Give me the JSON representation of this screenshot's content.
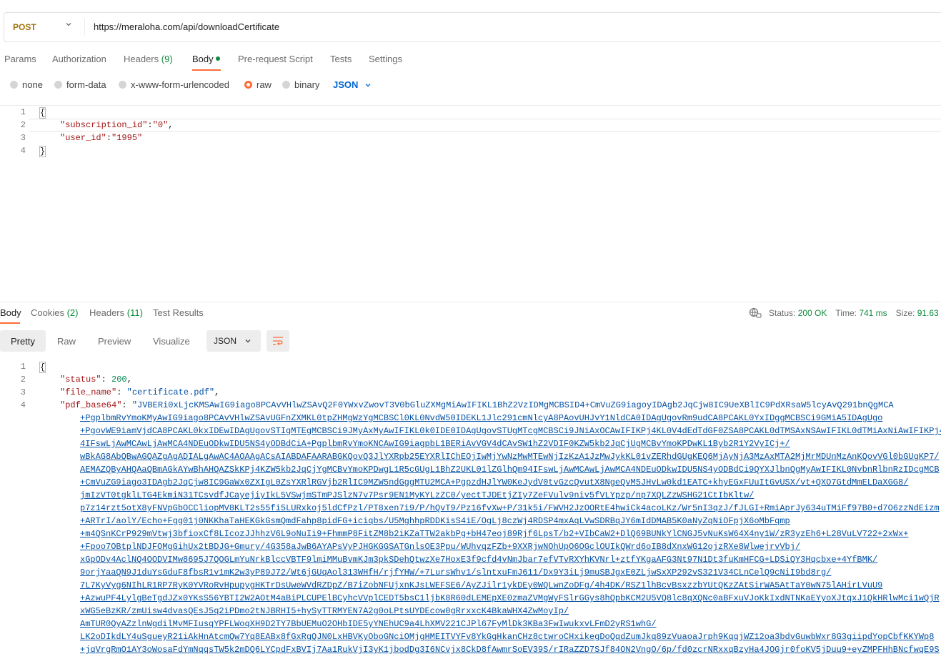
{
  "request": {
    "method": "POST",
    "url": "https://meraloha.com/api/downloadCertificate",
    "tabs": [
      {
        "label": "Params",
        "count": ""
      },
      {
        "label": "Authorization",
        "count": ""
      },
      {
        "label": "Headers",
        "count": "(9)"
      },
      {
        "label": "Body",
        "count": ""
      },
      {
        "label": "Pre-request Script",
        "count": ""
      },
      {
        "label": "Tests",
        "count": ""
      },
      {
        "label": "Settings",
        "count": ""
      }
    ],
    "active_tab": "Body",
    "body_types": [
      "none",
      "form-data",
      "x-www-form-urlencoded",
      "raw",
      "binary"
    ],
    "selected_body_type": "raw",
    "format": "JSON",
    "line_numbers": [
      "1",
      "2",
      "3",
      "4"
    ],
    "body_lines": {
      "open": "{",
      "key1": "\"subscription_id\"",
      "val1": "\"0\"",
      "key2": "\"user_id\"",
      "val2": "\"1995\"",
      "close": "}"
    }
  },
  "response": {
    "tabs": [
      {
        "label": "Body",
        "count": ""
      },
      {
        "label": "Cookies",
        "count": "(2)"
      },
      {
        "label": "Headers",
        "count": "(11)"
      },
      {
        "label": "Test Results",
        "count": ""
      }
    ],
    "status_label": "Status:",
    "status_value": "200 OK",
    "time_label": "Time:",
    "time_value": "741 ms",
    "size_label": "Size:",
    "size_value": "91.63 KB",
    "view_tabs": [
      "Pretty",
      "Raw",
      "Preview",
      "Visualize"
    ],
    "format": "JSON",
    "line_numbers": [
      "1",
      "2",
      "3",
      "4"
    ],
    "json": {
      "open": "{",
      "status_key": "\"status\"",
      "status_value": "200",
      "file_name_key": "\"file_name\"",
      "file_name_value": "\"certificate.pdf\"",
      "pdf_key": "\"pdf_base64\"",
      "pdf_first": "\"JVBERi0xLjcKMSAwIG9iago8PCAvVHlwZSAvQ2F0YWxvZwovT3V0bGluZXMgMiAwIFIKL1BhZ2VzIDMgMCBSID4+CmVuZG9iagoyIDAgb2JqCjw8IC9UeXBlIC9PdXRsaW5lcyAvQ291bnQgMCA",
      "pdf_lines": [
        "+PgplbmRvYmoKMyAwIG9iago8PCAvVHlwZSAvUGFnZXMKL0tpZHMgWzYgMCBSCl0KL0NvdW50IDEKL1Jlc291cmNlcyA8PAovUHJvY1NldCA0IDAgUgovRm9udCA8PCAKL0YxIDggMCBSCi9GMiA5IDAgUgo",
        "+PgovWE9iamVjdCA8PCAKL0kxIDEwIDAgUgovSTIgMTEgMCBSCi9JMyAxMyAwIFIKL0k0IDE0IDAgUgovSTUgMTcgMCBSCi9JNiAxOCAwIFIKPj4KL0V4dEdTdGF0ZSA8PCAKL0dTMSAxNSAwIFIKL0dTMiAxNiAwIFIKPj4",
        "4IFswLjAwMCAwLjAwMCA4NDEuODkwIDU5NS4yODBdCiA+PgplbmRvYmoKNCAwIG9iagpbL1BERiAvVGV4dCAvSW1hZ2VDIF0KZW5kb2JqCjUgMCBvYmoKPDwKL1Byb2R1Y2VyICj+/",
        "wBkAG8AbQBwAGQAZgAgADIALgAwAC4AOAAgACsAIABDAFAARABGKQovQ3JlYXRpb25EYXRlIChEOjIwMjYwNzMwMTEwNjIzKzA1JzMwJykKL01vZERhdGUgKEQ6MjAyNjA3MzAxMTA2MjMrMDUnMzAnKQovVGl0bGUgKP7/",
        "AEMAZQByAHQAaQBmAGkAYwBhAHQAZSkKPj4KZW5kb2JqCjYgMCBvYmoKPDwgL1R5cGUgL1BhZ2UKL01lZGlhQm94IFswLjAwMCAwLjAwMCA4NDEuODkwIDU5NS4yODBdCi9QYXJlbnQgMyAwIFIKL0NvbnRlbnRzIDcgMCB",
        "+CmVuZG9iago3IDAgb2JqCjw8IC9GaWx0ZXIgL0ZsYXRlRGVjb2RlIC9MZW5ndGggMTU2MCA+PgpzdHJlYW0KeJydV0tvGzcQvutX8NgeQvM5JHvLw0kd1EATC+khyEGxFUuItGvUSX/vt+QXO7GtdMmELDaXGG8/",
        "jmIzVT0tgklLTG4EkmiN31TCsvdfJCayejiyIkL5VSwjmSTmPJSlzN7v7Psr9EN1MyKYLzZC0/yectTJDEtjZIy7ZeFVulv9niv5fVLYpzp/np7XQLZzWSHG21CtIbKltw/",
        "p7z14rzt5otX8yFNVpGbOCCliopMV8KLT2s55fi5LURxkoj5ldCfPzl/PT8xen7i9/P/hQvT9/Pz16fvXw+P/31k5i/FWVH2JzOORtE4hwiCk4acoLKz/Wr5nI3qzJ/fJLGI+RmiAprJy634uTMiFf97B0+d7O6zzNdEizm",
        "+ARTrI/aolY/Echo+Fgg01j0NKKhaTaHEKGkGsmQmdFahp8pidFG+iciqbs/U5MghhpRDDKisS4iE/OgLj8czWj4RDSP4mxAqLVwSDRBqJY6mIdDMAB5K0aNyZqNiOFpjX6oMbFqmp",
        "+m4QSnKCrP929mVtwj3bfioxCf8LIcozJJhhzV6L9oNuIi9+FhmmP8FitZM8b2iKZaTTW2akbPg+bH47eoj89Rjf6LpsT/b2+VIbCaW2+DlQ69BUNkYlCNGJ5vNuKsW64X4ny1W/zR3yzEh6+L28VuLV722+2xWx+",
        "+Fpoo7OBtplNDJFOMgGihUx2tBDJG+Gmury/4G358aJwB6AYAPsVyPJHGKGGSATGnlsOE3Ppu/WUhvqzFZb+9XXRjwNOhUpO6OGclOUIkQWrd6oIB8dXnxWG12ojzRXe8WlwejrvVbj/",
        "xGpODv4AclNQ4OODVIMw8695J7QOGLmYuNrkBlccVBTF9lmiMMuBvmKJm3pkSDehQtwzXe7HoxE3f9cfd4vNmJbar7efVTvRXYhKVNrl+ztfYKgaAFG3Nt97N1Dt3fuKmHFCG+LDSiQY3Hqcbxe+4YfBMK/",
        "9orjYaaQN9J1duYsGduF8fbsR1v1mK2w3yP89J72/Wt6jGUqAol313WHfH/rjfYHW/+7LursWhv1/slntxuFmJ611/Dx9Y3iLj9muSBJgxE0ZLjwSxXP292vS321V34CLnCelQ9cNiI9bd8rg/",
        "7L7KyVyg6NIhLR1RP7RyK0YVRoRvHpupygHKTrDsUweWVdRZDpZ/B7iZobNFUjxnKJsLWEFSE6/AyZJilr1ykDEy0WQLwnZoDFg/4h4DK/RSZ1lhBcvBsxzzbYUtQKzZAtSirWA5AtTaY0wN75lAHirLVuU9",
        "+AzwuPF4LylgBeTgdJZx0YKsS56YBTI2W2AOtM4aBiPLCUPElBCyhcVVplCEDT5bsC1ljbK8R60dLEMEpXE0zmaZVMgWyFSlrGGys8hQpbKCM2U5VQ8lc8qXQNc0aBFxuVJoKkIxdNTNKaEYyoXJtqxJ1QkHRlwMci1wQjR",
        "xWG5eBzKR/zmUisw4dvasQEsJ5q2iPDmo2tNJBRHI5+hySyTTRMYEN7A2g0oLPtsUYDEcow0gRrxxcK4BkaWHX4ZwMoyIp/",
        "AmTUR0QyAZzlnWgdilMvMFIusqYPFLWoqXH9D2TY7BbUEMuO2OHbIDE5yYNEhUC9a4LhXMV221CJPl67FyMlDk3KBa3FwIwukxvLFmD2yRS1whG/",
        "LK2oDIkdLY4uSgueyR21iAkHnAtcmQw7Yq8EABx8fGxRgQJN0LxHBVKyOboGNciOMjgHMEITVYFv8YkGgHkanCHz8ctwroCHxikegDoQqdZumJkq89zVuaoaJrph9KqqjWZ12oa3bdvGuwbWxr8G3giipdYopCbfKKYWp8",
        "+jqVrgRmO1AY3oWosaFdYmNqqsTW5k2mDQ6LYCpdFxBVIj7Aa1RukVjI3yK1jbodDg3I6NCvjx8CkD8fAwmrSoEV39S/rIRaZZD7SJf84ON2VngO/6p/fd0zcrNRxxqBzyHa4JOGjr0foKV5jDuu9+eyZMPFHhBNcfwqE9S"
      ],
      "close": "}"
    }
  }
}
